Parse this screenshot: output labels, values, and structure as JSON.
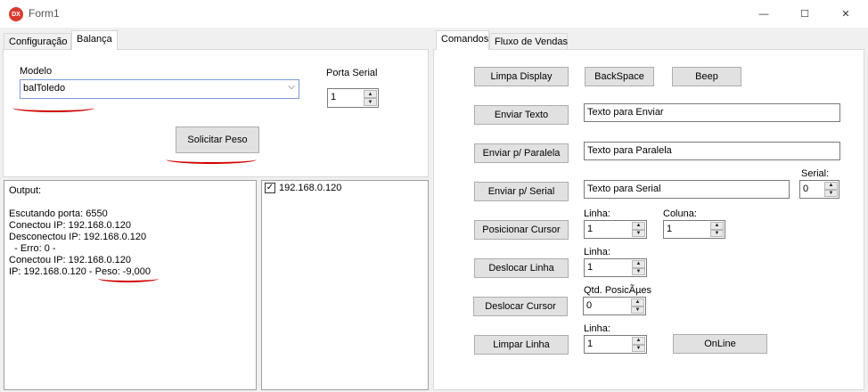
{
  "window": {
    "title": "Form1",
    "icon_label": "DX",
    "minimize_glyph": "—",
    "maximize_glyph": "☐",
    "close_glyph": "✕"
  },
  "left_tabs": [
    {
      "label": "Configuração",
      "active": false
    },
    {
      "label": "Balança",
      "active": true
    }
  ],
  "balanca": {
    "modelo_label": "Modelo",
    "modelo_value": "balToledo",
    "porta_label": "Porta Serial",
    "porta_value": "1",
    "solicitar_label": "Solicitar Peso"
  },
  "output": {
    "lines": [
      "Output:",
      "",
      "Escutando porta: 6550",
      "Conectou IP: 192.168.0.120",
      "Desconectou IP: 192.168.0.120",
      "  - Erro: 0 -",
      "Conectou IP: 192.168.0.120",
      "IP: 192.168.0.120 - Peso: -9,000"
    ]
  },
  "ip_list": {
    "items": [
      {
        "label": "192.168.0.120",
        "checked": true
      }
    ]
  },
  "right_tabs": [
    {
      "label": "Comandos",
      "active": true
    },
    {
      "label": "Fluxo de Vendas",
      "active": false
    }
  ],
  "comandos": {
    "limpa_display": "Limpa Display",
    "backspace": "BackSpace",
    "beep": "Beep",
    "enviar_texto": "Enviar Texto",
    "enviar_texto_value": "Texto para Enviar",
    "enviar_paralela": "Enviar p/ Paralela",
    "enviar_paralela_value": "Texto para Paralela",
    "enviar_serial": "Enviar p/ Serial",
    "enviar_serial_value": "Texto para Serial",
    "serial_label": "Serial:",
    "serial_value": "0",
    "posicionar_cursor": "Posicionar Cursor",
    "linha_label": "Linha:",
    "coluna_label": "Coluna:",
    "pos_linha_value": "1",
    "pos_coluna_value": "1",
    "deslocar_linha": "Deslocar Linha",
    "desl_linha_label": "Linha:",
    "desl_linha_value": "1",
    "deslocar_cursor": "Deslocar Cursor",
    "qtd_label": "Qtd. PosicÃµes",
    "qtd_value": "0",
    "limpar_linha": "Limpar Linha",
    "limpar_linha_label": "Linha:",
    "limpar_linha_value": "1",
    "online": "OnLine"
  },
  "spin_up_glyph": "▲",
  "spin_down_glyph": "▼",
  "dropdown_glyph": "⌵",
  "checkbox_glyph": "✓",
  "colors": {
    "annotation_red": "#d00000",
    "close_icon_red": "#d83b2f"
  }
}
